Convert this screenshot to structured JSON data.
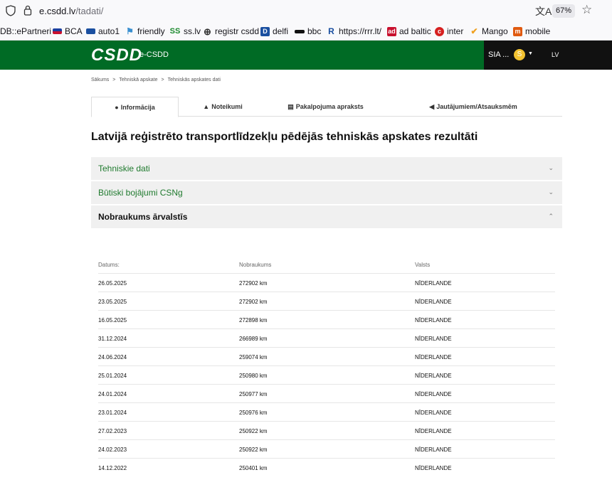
{
  "browser": {
    "url_domain": "e.csdd.lv",
    "url_path": "/tadati/",
    "zoom": "67%",
    "bookmarks": [
      {
        "label": "DB::ePartneri",
        "icon": "dot-icon"
      },
      {
        "label": "BCA",
        "icon": "flag-icon"
      },
      {
        "label": "auto1",
        "icon": "car-icon"
      },
      {
        "label": "friendly",
        "icon": "flag-icon"
      },
      {
        "label": "ss.lv",
        "icon": "ss-icon",
        "icon_text": "SS"
      },
      {
        "label": "registr csdd",
        "icon": "globe-icon"
      },
      {
        "label": "delfi",
        "icon": "delfi-icon",
        "icon_text": "D"
      },
      {
        "label": "bbc",
        "icon": "bbc-icon"
      },
      {
        "label": "https://rrr.lt/",
        "icon": "rrr-icon"
      },
      {
        "label": "ad baltic",
        "icon": "ad-icon",
        "icon_text": "ad"
      },
      {
        "label": "inter",
        "icon": "inter-icon"
      },
      {
        "label": "Mango",
        "icon": "mango-icon"
      },
      {
        "label": "mobile",
        "icon": "mobile-icon",
        "icon_text": "m"
      }
    ]
  },
  "header": {
    "logo": "CSDD",
    "app_name": "e-CSDD",
    "user": "SIA ...",
    "coin_symbol": "S",
    "lang": "LV",
    "brand_color": "#006b25"
  },
  "breadcrumb": [
    "Sākums",
    "Tehniskā apskate",
    "Tehniskās apskates dati"
  ],
  "tabs": [
    {
      "label": "Informācija",
      "icon": "info-icon"
    },
    {
      "label": "Noteikumi",
      "icon": "warning-icon"
    },
    {
      "label": "Pakalpojuma apraksts",
      "icon": "document-icon"
    },
    {
      "label": "Jautājumiem/Atsauksmēm",
      "icon": "megaphone-icon"
    }
  ],
  "page_title": "Latvijā reģistrēto transportlīdzekļu pēdējās tehniskās apskates rezultāti",
  "accordion": [
    {
      "label": "Tehniskie dati",
      "expanded": false
    },
    {
      "label": "Būtiski bojājumi CSNg",
      "expanded": false
    },
    {
      "label": "Nobraukums ārvalstīs",
      "expanded": true
    }
  ],
  "table": {
    "headers": [
      "Datums:",
      "Nobraukums",
      "Valsts"
    ],
    "rows": [
      [
        "26.05.2025",
        "272902 km",
        "NĪDERLANDE"
      ],
      [
        "23.05.2025",
        "272902 km",
        "NĪDERLANDE"
      ],
      [
        "16.05.2025",
        "272898 km",
        "NĪDERLANDE"
      ],
      [
        "31.12.2024",
        "266989 km",
        "NĪDERLANDE"
      ],
      [
        "24.06.2024",
        "259074 km",
        "NĪDERLANDE"
      ],
      [
        "25.01.2024",
        "250980 km",
        "NĪDERLANDE"
      ],
      [
        "24.01.2024",
        "250977 km",
        "NĪDERLANDE"
      ],
      [
        "23.01.2024",
        "250976 km",
        "NĪDERLANDE"
      ],
      [
        "27.02.2023",
        "250922 km",
        "NĪDERLANDE"
      ],
      [
        "24.02.2023",
        "250922 km",
        "NĪDERLANDE"
      ],
      [
        "14.12.2022",
        "250401 km",
        "NĪDERLANDE"
      ]
    ]
  }
}
